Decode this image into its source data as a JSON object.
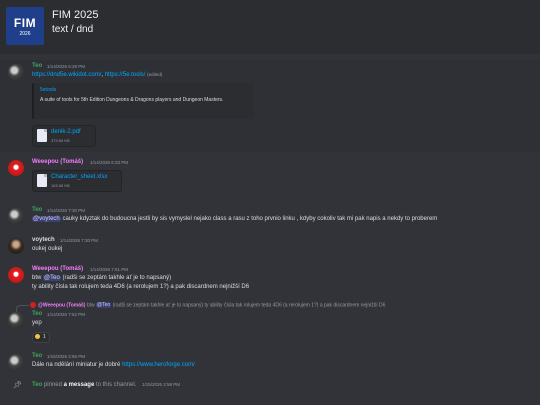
{
  "server": {
    "name": "FIM 2025",
    "icon_text": "FIM",
    "icon_year": "2026",
    "channel_path": "text / dnd"
  },
  "colors": {
    "teo": "#3ba55c",
    "weeepou": "#f47fff",
    "voytech": "#dbdee1",
    "link": "#00a8fc"
  },
  "messages": [
    {
      "user": "Teo",
      "time": "1/14/2026 6:28 PM",
      "link1": "https://dnd5e.wikidot.com/",
      "sep": ", ",
      "link2": "https://5e.tools/",
      "edited": "(edited)",
      "embed": {
        "title": "5etools",
        "desc": "A suite of tools for 5th Edition Dungeons & Dragons players and Dungeon Masters."
      },
      "file": {
        "name": "denik-2.pdf",
        "size": "379.59 KB"
      }
    },
    {
      "user": "Weeepou (Tomáš)",
      "time": "1/14/2026 6:33 PM",
      "file": {
        "name": "Character_sheet.xlsx",
        "size": "163.06 KB"
      }
    },
    {
      "user": "Teo",
      "time": "1/14/2026 7:30 PM",
      "mention": "@voytech",
      "text": " cauky kdyztak do budoucna jestli by sis vymyslel nejako class a rasu z toho prvnio linku , kdyby cokoliv tak mi  pak napis a nekdy to proberem"
    },
    {
      "user": "voytech",
      "time": "1/14/2026 7:30 PM",
      "text": "oukej oukej"
    },
    {
      "user": "Weeepou (Tomáš)",
      "time": "1/14/2026 7:51 PM",
      "line1_pre": "btw ",
      "mention": "@Teo",
      "line1_post": " (radši se zeptám takhle ať je to napsaný)",
      "line2": "ty ability čísla tak rolujem teda 4D6 (a rerolujem 1?) a pak discardnem nejnižší D6"
    },
    {
      "reply": {
        "name": "@Weeepou (Tomáš)",
        "pre": " btw ",
        "mention": "@Teo",
        "text": " (radši se zeptám takhle ať je to napsaný) ty ability čísla tak rolujem teda 4D6 (a rerolujem 1?) a pak discardnem nejnižší D6"
      },
      "user": "Teo",
      "time": "1/14/2026 7:52 PM",
      "text": "yep",
      "reaction_count": "1"
    },
    {
      "user": "Teo",
      "time": "1/15/2026 2:56 PM",
      "text": "Dále na ndělání miniatur je dobré ",
      "link": "https://www.heroforge.com/"
    },
    {
      "user": "Teo",
      "pinned_pre": " pinned ",
      "pinned_b": "a message",
      "pinned_post": " to this channel.",
      "time": "1/15/2026 2:58 PM"
    }
  ]
}
